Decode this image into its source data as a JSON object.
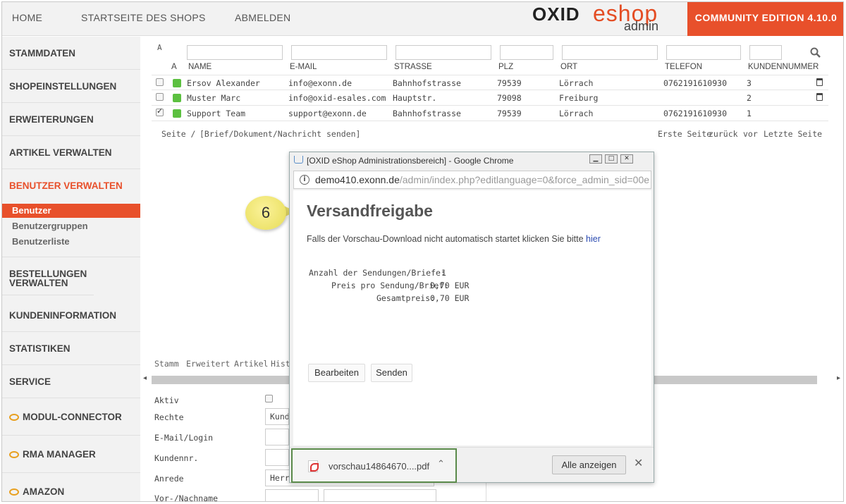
{
  "topnav": {
    "home": "HOME",
    "shop_start": "STARTSEITE DES SHOPS",
    "logout": "ABMELDEN"
  },
  "logo": {
    "oxid": "OXID",
    "eshop": "eshop",
    "admin": "admin"
  },
  "edition": "COMMUNITY EDITION 4.10.0",
  "sidebar": {
    "items": [
      {
        "label": "STAMMDATEN"
      },
      {
        "label": "SHOPEINSTELLUNGEN"
      },
      {
        "label": "ERWEITERUNGEN"
      },
      {
        "label": "ARTIKEL VERWALTEN"
      },
      {
        "label": "BENUTZER VERWALTEN"
      },
      {
        "label": "BESTELLUNGEN VERWALTEN"
      },
      {
        "label": "KUNDENINFORMATION"
      },
      {
        "label": "STATISTIKEN"
      },
      {
        "label": "SERVICE"
      },
      {
        "label": "MODUL-CONNECTOR"
      },
      {
        "label": "RMA MANAGER"
      },
      {
        "label": "AMAZON"
      }
    ],
    "subitems": [
      {
        "label": "Benutzer"
      },
      {
        "label": "Benutzergruppen"
      },
      {
        "label": "Benutzerliste"
      }
    ]
  },
  "list": {
    "filter_a": "A",
    "columns": {
      "a": "A",
      "name": "NAME",
      "email": "E-MAIL",
      "street": "STRASSE",
      "zip": "PLZ",
      "city": "ORT",
      "phone": "TELEFON",
      "custno": "KUNDENNUMMER"
    },
    "rows": [
      {
        "name": "Ersov Alexander",
        "email": "info@exonn.de",
        "street": "Bahnhofstrasse",
        "zip": "79539",
        "city": "Lörrach",
        "phone": "0762191610930",
        "custno": "3",
        "checked": false
      },
      {
        "name": "Muster Marc",
        "email": "info@oxid-esales.com",
        "street": "Hauptstr.",
        "zip": "79098",
        "city": "Freiburg",
        "phone": "",
        "custno": "2",
        "checked": false
      },
      {
        "name": "Support Team",
        "email": "support@exonn.de",
        "street": "Bahnhofstrasse",
        "zip": "79539",
        "city": "Lörrach",
        "phone": "0762191610930",
        "custno": "1",
        "checked": true
      }
    ],
    "pager_left": "Seite /",
    "send_link": "[Brief/Dokument/Nachricht senden]",
    "first": "Erste Seite",
    "back": "zurück",
    "fwd": "vor",
    "last": "Letzte Seite"
  },
  "tabs": [
    {
      "label": "Stamm"
    },
    {
      "label": "Erweitert"
    },
    {
      "label": "Artikel"
    },
    {
      "label": "Histo"
    }
  ],
  "form": {
    "active": "Aktiv",
    "rights": "Rechte",
    "rights_value": "Kunde",
    "login": "E-Mail/Login",
    "custno": "Kundennr.",
    "salutation": "Anrede",
    "salutation_value": "Herr",
    "name": "Vor-/Nachname"
  },
  "popup": {
    "title": "[OXID eShop Administrationsbereich] - Google Chrome",
    "url_host": "demo410.exonn.de",
    "url_path": "/admin/index.php?editlanguage=0&force_admin_sid=00e",
    "heading": "Versandfreigabe",
    "note": "Falls der Vorschau-Download nicht automatisch startet klicken Sie bitte",
    "note_link": "hier",
    "count_label": "Anzahl der Sendungen/Briefe:",
    "count_value": "1",
    "price_label": "Preis pro Sendung/Brief:",
    "price_value": "0,70 EUR",
    "total_label": "Gesamtpreis:",
    "total_value": "0,70 EUR",
    "edit_btn": "Bearbeiten",
    "send_btn": "Senden",
    "download_name": "vorschau14864670....pdf",
    "show_all": "Alle anzeigen"
  },
  "callout": "6",
  "colors": {
    "accent": "#e8502b",
    "status_active": "#5cc040",
    "callout": "#ede36b",
    "highlight_border": "#5a8a4a"
  }
}
